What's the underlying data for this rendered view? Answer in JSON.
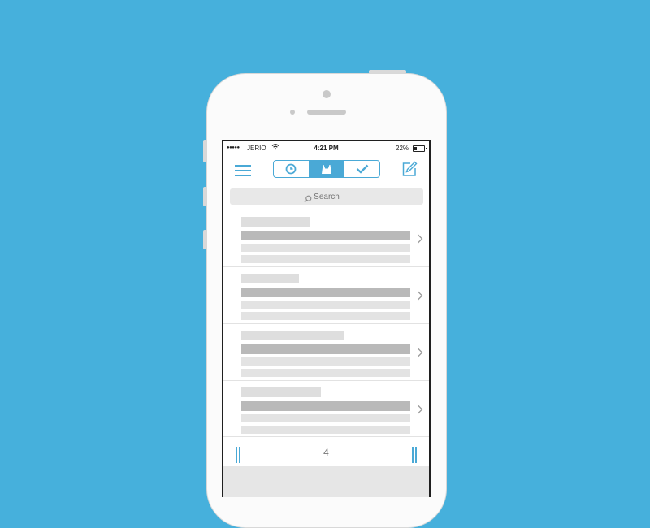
{
  "status_bar": {
    "signal": "●●●●●",
    "carrier": "JERIO",
    "time": "4:21 PM",
    "battery": "22%",
    "battery_level": 0.22
  },
  "toolbar": {
    "menu_icon": "hamburger-menu-icon",
    "tabs": [
      {
        "icon": "clock-icon",
        "active": false
      },
      {
        "icon": "inbox-icon",
        "active": true
      },
      {
        "icon": "checkmark-icon",
        "active": false
      }
    ],
    "compose_icon": "compose-icon"
  },
  "search": {
    "placeholder": "Search"
  },
  "messages": [
    {
      "title_width": 0.41
    },
    {
      "title_width": 0.34
    },
    {
      "title_width": 0.61
    },
    {
      "title_width": 0.47
    }
  ],
  "pager": {
    "page": "4"
  },
  "colors": {
    "background": "#46b0dc",
    "accent": "#4aa9d6",
    "placeholder_light": "#dedede",
    "placeholder_dark": "#b9b9b9"
  }
}
